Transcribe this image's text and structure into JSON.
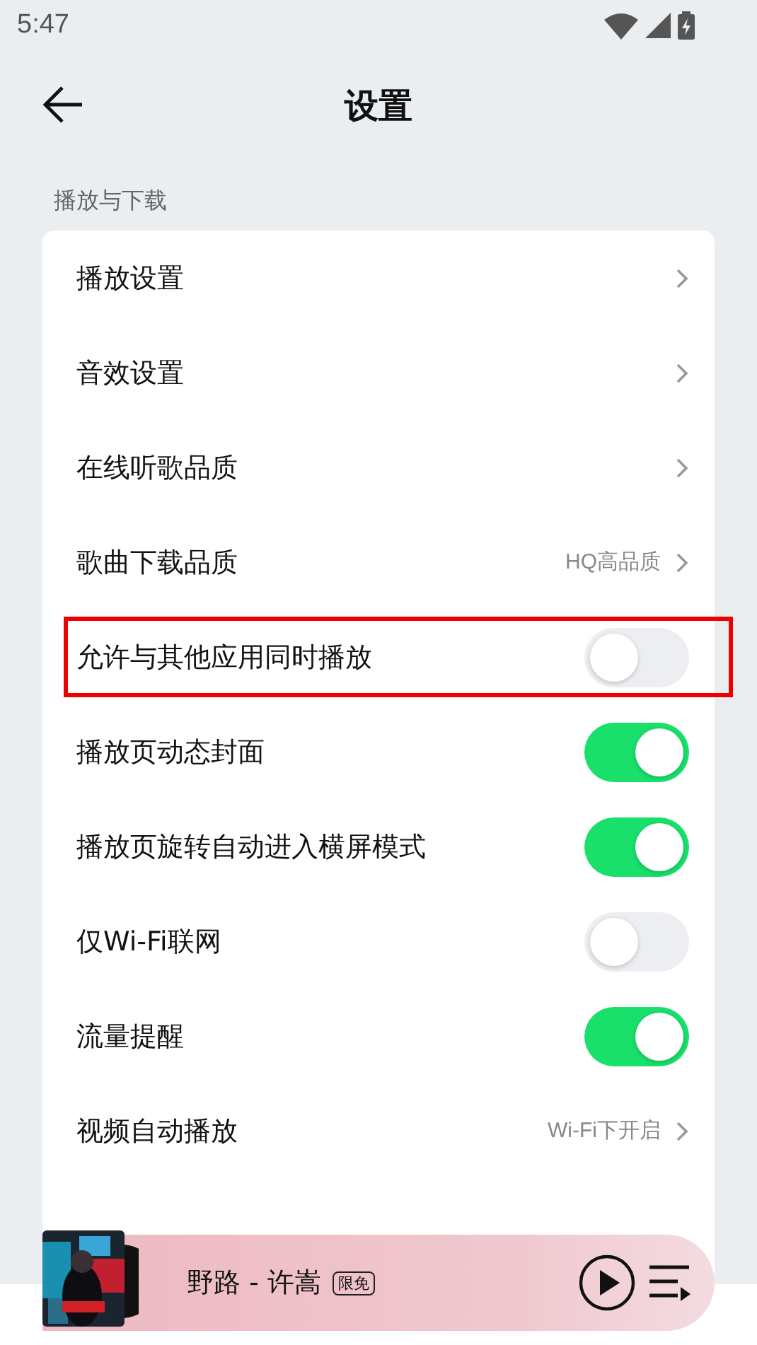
{
  "status_bar": {
    "time": "5:47"
  },
  "header": {
    "title": "设置"
  },
  "section": {
    "label": "播放与下载"
  },
  "rows": [
    {
      "kind": "link",
      "label": "播放设置",
      "highlighted": false
    },
    {
      "kind": "link",
      "label": "音效设置",
      "highlighted": false
    },
    {
      "kind": "link",
      "label": "在线听歌品质",
      "highlighted": false
    },
    {
      "kind": "link",
      "label": "歌曲下载品质",
      "value": "HQ高品质",
      "highlighted": false
    },
    {
      "kind": "toggle",
      "label": "允许与其他应用同时播放",
      "on": false,
      "highlighted": true
    },
    {
      "kind": "toggle",
      "label": "播放页动态封面",
      "on": true,
      "highlighted": false
    },
    {
      "kind": "toggle",
      "label": "播放页旋转自动进入横屏模式",
      "on": true,
      "highlighted": false
    },
    {
      "kind": "toggle",
      "label": "仅Wi-Fi联网",
      "on": false,
      "highlighted": false
    },
    {
      "kind": "toggle",
      "label": "流量提醒",
      "on": true,
      "highlighted": false
    },
    {
      "kind": "link",
      "label": "视频自动播放",
      "value": "Wi-Fi下开启",
      "highlighted": false
    }
  ],
  "player": {
    "song": "野路 - 许嵩",
    "badge": "限免"
  }
}
